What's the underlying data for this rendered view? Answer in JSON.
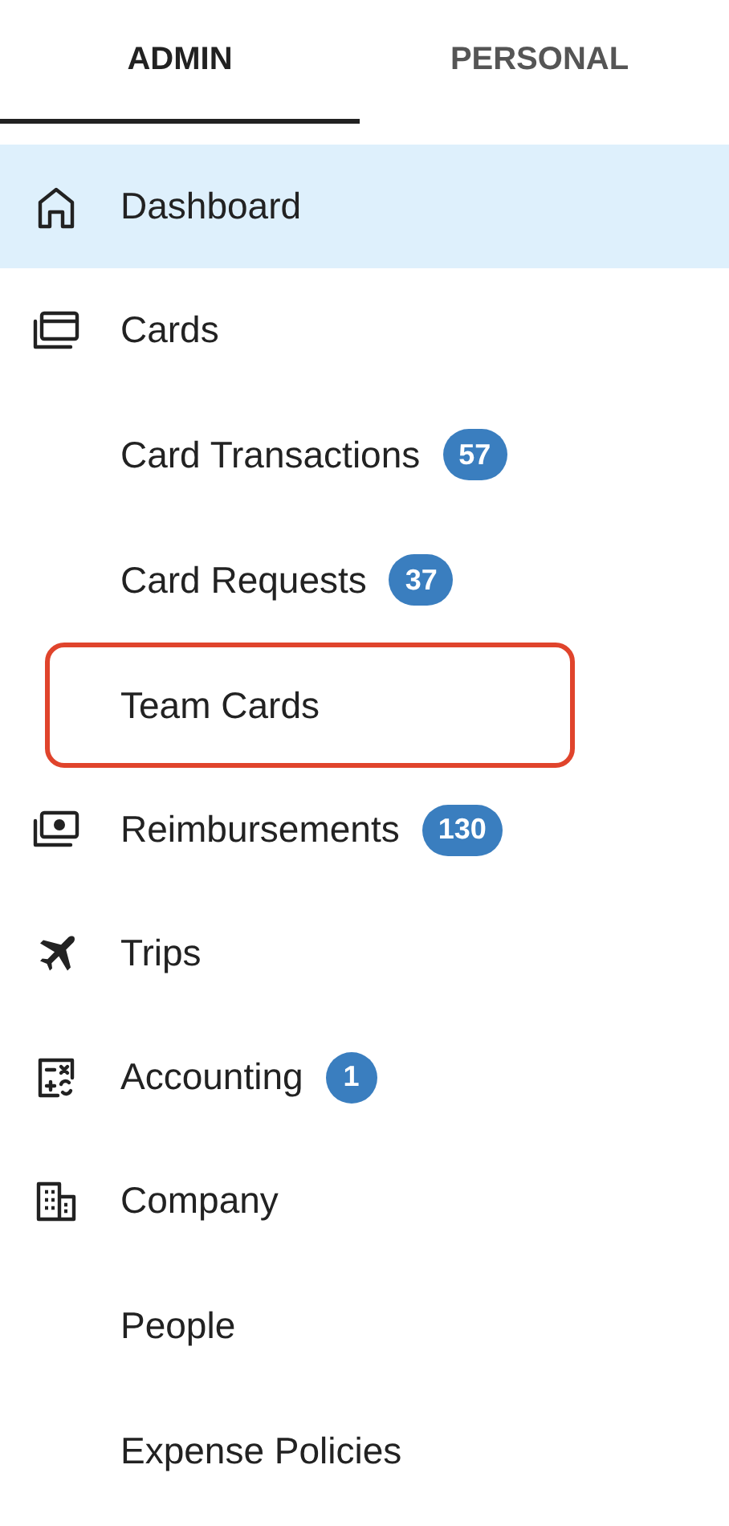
{
  "tabs": [
    {
      "label": "ADMIN",
      "selected": true
    },
    {
      "label": "PERSONAL",
      "selected": false
    }
  ],
  "sidebar": {
    "items": [
      {
        "label": "Dashboard",
        "selected": true
      },
      {
        "label": "Cards",
        "selected": false,
        "children": [
          {
            "label": "Card Transactions",
            "badge": "57",
            "highlighted": false
          },
          {
            "label": "Card Requests",
            "badge": "37",
            "highlighted": false
          },
          {
            "label": "Team Cards",
            "highlighted": true
          }
        ]
      },
      {
        "label": "Reimbursements",
        "badge": "130",
        "selected": false
      },
      {
        "label": "Trips",
        "selected": false
      },
      {
        "label": "Accounting",
        "badge": "1",
        "selected": false
      },
      {
        "label": "Company",
        "selected": false,
        "children": [
          {
            "label": "People",
            "highlighted": false
          },
          {
            "label": "Expense Policies",
            "highlighted": false
          }
        ]
      }
    ]
  }
}
